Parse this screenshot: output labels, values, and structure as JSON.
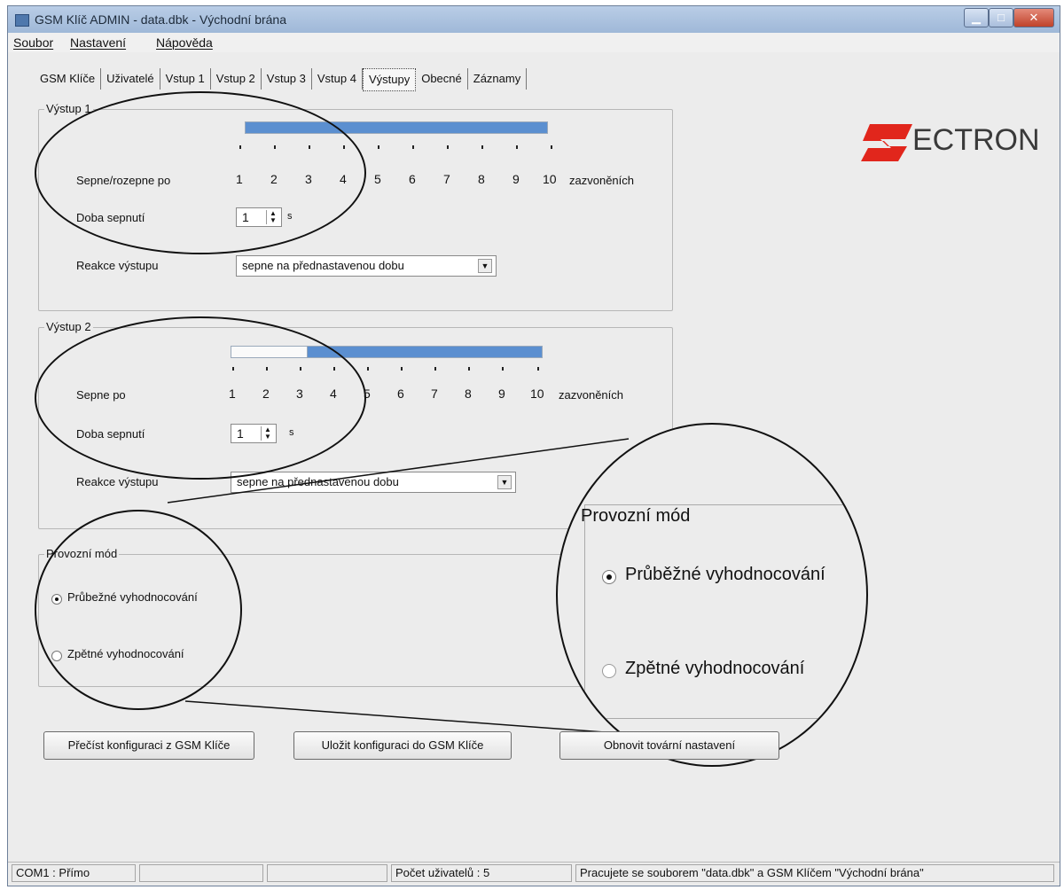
{
  "window": {
    "title": "GSM Klíč ADMIN - data.dbk - Východní brána"
  },
  "menu": {
    "file": "Soubor",
    "settings": "Nastavení",
    "help": "Nápověda"
  },
  "tabs": [
    "GSM Klíče",
    "Uživatelé",
    "Vstup 1",
    "Vstup 2",
    "Vstup 3",
    "Vstup 4",
    "Výstupy",
    "Obecné",
    "Záznamy"
  ],
  "active_tab": "Výstupy",
  "logo": {
    "text": "ECTRON",
    "brand_color": "#e1261c"
  },
  "output1": {
    "title": "Výstup 1",
    "label": "Sepne/rozepne po",
    "scale": [
      "1",
      "2",
      "3",
      "4",
      "5",
      "6",
      "7",
      "8",
      "9",
      "10"
    ],
    "unit": "zazvoněních",
    "slider_value": 1,
    "duration_label": "Doba sepnutí",
    "duration_value": "1",
    "duration_unit": "s",
    "reaction_label": "Reakce výstupu",
    "reaction_value": "sepne na přednastavenou dobu"
  },
  "output2": {
    "title": "Výstup 2",
    "label": "Sepne po",
    "scale": [
      "1",
      "2",
      "3",
      "4",
      "5",
      "6",
      "7",
      "8",
      "9",
      "10"
    ],
    "unit": "zazvoněních",
    "slider_value": 3,
    "duration_label": "Doba sepnutí",
    "duration_value": "1",
    "duration_unit": "s",
    "reaction_label": "Reakce výstupu",
    "reaction_value": "sepne na přednastavenou dobu"
  },
  "mode": {
    "title": "Provozní mód",
    "option1": "Průbežné vyhodnocování",
    "option2": "Zpětné vyhodnocování",
    "zoom_option1": "Průběžné vyhodnocování",
    "zoom_option2": "Zpětné vyhodnocování",
    "selected": 1
  },
  "buttons": {
    "read": "Přečíst konfiguraci z GSM Klíče",
    "save": "Uložit konfiguraci do GSM Klíče",
    "reset": "Obnovit tovární nastavení"
  },
  "status": {
    "port": "COM1 : Přímo",
    "users": "Počet uživatelů : 5",
    "info": "Pracujete se souborem \"data.dbk\" a GSM Klíčem \"Východní brána\""
  },
  "colors": {
    "slider": "#5b8fd0",
    "window_bg": "#ececec",
    "titlebar": "#a9c0dd"
  }
}
